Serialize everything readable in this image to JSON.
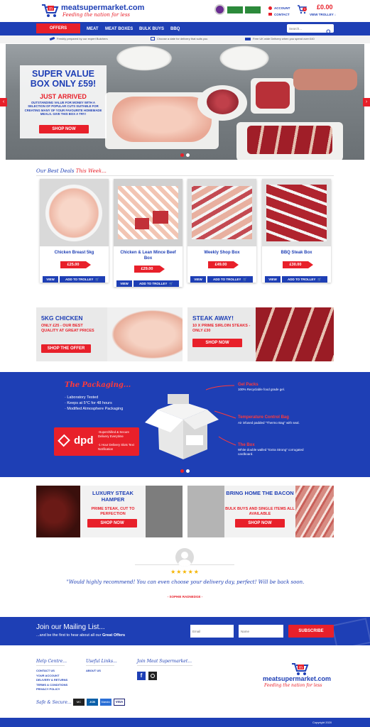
{
  "header": {
    "logo_name": "meatsupermarket.com",
    "tagline": "Feeding the nation for less",
    "account": "ACCOUNT",
    "contact": "CONTACT",
    "cart_total": "£0.00",
    "cart_count": "0",
    "view_trolley": "VIEW TROLLEY ↓"
  },
  "nav": {
    "offers": "OFFERS",
    "items": [
      "MEAT",
      "MEAT BOXES",
      "BULK BUYS",
      "BBQ"
    ],
    "search_placeholder": "Search..."
  },
  "usp": [
    "Freshly prepared by our expert Butchers",
    "Choose a date for delivery that suits you",
    "Free UK wide Delivery when you spend over £40"
  ],
  "hero": {
    "title": "SUPER VALUE BOX ONLY £59!",
    "subtitle": "JUST ARRIVED",
    "body": "OUTSTANDING VALUE FOR MONEY WITH A SELECTION OF POPULAR CUTS SUITABLE FOR CREATING MANY OF YOUR FAVOURITE HOMEMADE MEALS. GIVE THIS BOX A TRY!",
    "cta": "SHOP NOW"
  },
  "best_deals": {
    "heading_a": "Our Best Deals ",
    "heading_b": "This Week...",
    "products": [
      {
        "name": "Chicken Breast 5kg",
        "price": "£25.00",
        "view": "VIEW",
        "add": "ADD TO TROLLEY"
      },
      {
        "name": "Chicken & Lean Mince Beef Box",
        "price": "£29.00",
        "view": "VIEW",
        "add": "ADD TO TROLLEY"
      },
      {
        "name": "Weekly Shop Box",
        "price": "£49.00",
        "view": "VIEW",
        "add": "ADD TO TROLLEY"
      },
      {
        "name": "BBQ Steak Box",
        "price": "£30.00",
        "view": "VIEW",
        "add": "ADD TO TROLLEY"
      }
    ]
  },
  "promos": {
    "left": {
      "title": "5KG CHICKEN",
      "body": "ONLY £25 - OUR BEST QUALITY AT GREAT PRICES",
      "cta": "SHOP THE OFFER"
    },
    "right": {
      "title": "STEAK AWAY!",
      "body": "10 X PRIME SIRLOIN STEAKS - ONLY £30",
      "cta": "SHOP NOW"
    }
  },
  "packaging": {
    "title": "The Packaging...",
    "points": [
      "Laboratory Tested",
      "Keeps at 5°C for 48 hours",
      "Modified Atmosphere Packaging"
    ],
    "dpd_logo": "dpd",
    "dpd_lines": [
      "-Superchilled & Secure Delivery Everytime",
      "-1 Hour Delivery Slots Text Notification"
    ],
    "gel_title": "Gel Packs",
    "gel_body": "100% Recyclable food grade gel.",
    "temp_title": "Temperature Control Bag",
    "temp_body": "Air infused padded \"Thermo Bag\" with seal.",
    "box_title": "The Box",
    "box_body": "White double walled \"Extra Strong\" corrugated cardboard."
  },
  "hampers": {
    "left": {
      "title": "LUXURY STEAK HAMPER",
      "body": "PRIME STEAK, CUT TO PERFECTION",
      "cta": "SHOP NOW"
    },
    "right": {
      "title": "BRING HOME THE BACON",
      "body": "BULK BUYS AND SINGLE ITEMS ALL AVAILABLE",
      "cta": "SHOP NOW"
    }
  },
  "review": {
    "stars": "★★★★★",
    "quote": "\"Would highly recommend! You can even choose your delivery day, perfect! Will be back soon.",
    "author": "- SOPHIE RADNEDGE -"
  },
  "mailing": {
    "title": "Join our Mailing List...",
    "sub_a": "...and be the first to hear about all our ",
    "sub_b": "Great Offers",
    "email_placeholder": "Email",
    "name_placeholder": "Name",
    "subscribe": "SUBSCRIBE"
  },
  "footer": {
    "help_title": "Help Centre...",
    "help_links": [
      "CONTACT US",
      "YOUR ACCOUNT",
      "DELIVERY & RETURNS",
      "TERMS & CONDITIONS",
      "PRIVACY POLICY"
    ],
    "useful_title": "Useful Links...",
    "useful_links": [
      "ABOUT US"
    ],
    "join_title": "Join Meat Supermarket...",
    "safe_title": "Safe & Secure...",
    "cards": [
      "MC",
      "JCB",
      "Maestro",
      "VISA"
    ],
    "logo_name": "meatsupermarket.com",
    "tagline": "Feeding the nation for less",
    "copyright": "Copyright 2020"
  },
  "colors": {
    "brand_blue": "#1e3fb5",
    "brand_red": "#e8202a"
  }
}
